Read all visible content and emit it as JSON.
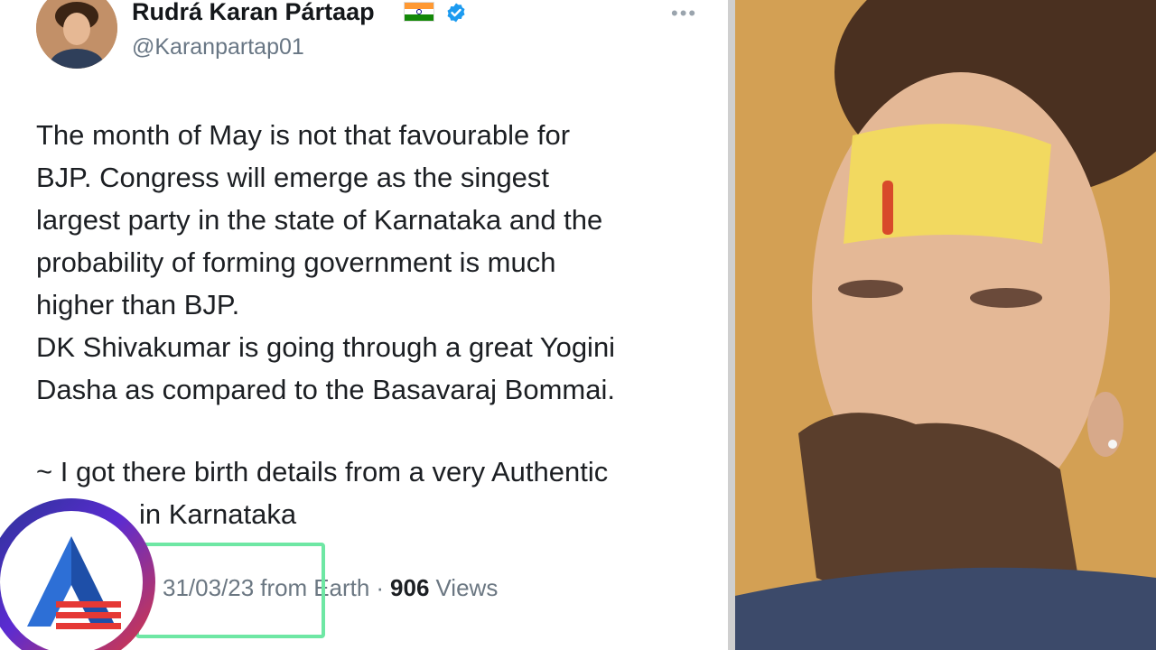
{
  "tweet": {
    "author_name": "Rudrá Karan Pártaap",
    "handle": "@Karanpartap01",
    "lines": [
      "The month of May is not that favourable for",
      "BJP. Congress will emerge as the singest",
      "largest party in the state of Karnataka and the",
      "probability of forming government is much",
      "higher than BJP.",
      "DK Shivakumar is going through a great Yogini",
      "Dasha as compared to the Basavaraj Bommai."
    ],
    "note_line1": "~ I got there birth details from a very Authentic",
    "note_line2": "in Karnataka",
    "meta": {
      "date": "31/03/23",
      "from_label": "from",
      "location": "Earth",
      "separator": "·",
      "views_count": "906",
      "views_label": "Views"
    }
  },
  "colors": {
    "verified": "#1d9bf0",
    "highlight": "#6ee7a4",
    "flag_saffron": "#ff9933",
    "flag_green": "#138808",
    "flag_chakra": "#000080"
  },
  "icons": {
    "verified": "verified-badge-icon",
    "flag": "india-flag-icon",
    "more": "more-options-icon",
    "logo": "news-channel-logo"
  }
}
